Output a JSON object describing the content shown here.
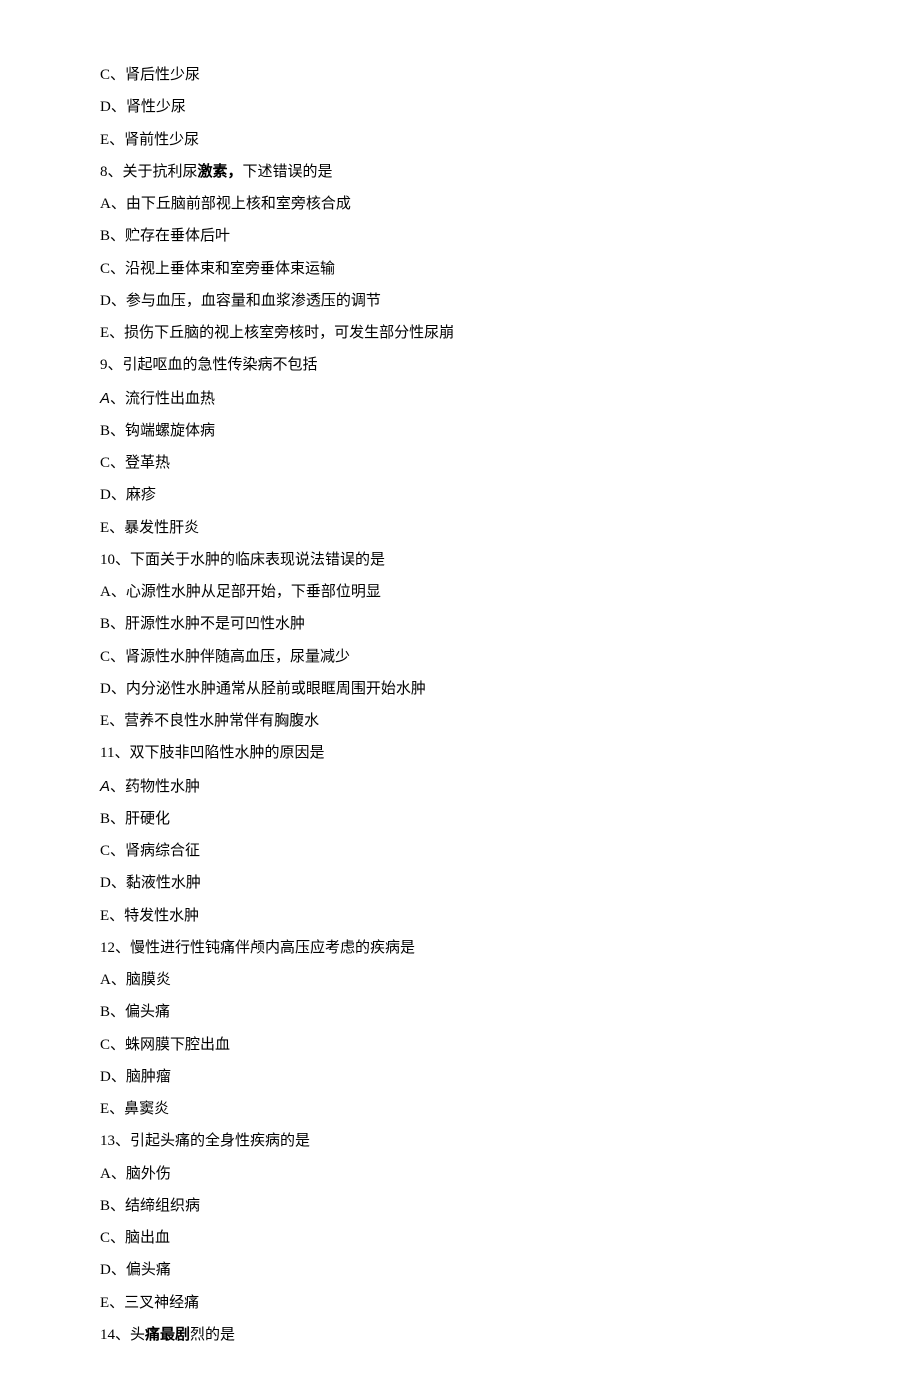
{
  "lines": [
    {
      "segments": [
        {
          "t": "C、肾后性少尿",
          "cls": ""
        }
      ]
    },
    {
      "segments": [
        {
          "t": "D、肾性少尿",
          "cls": ""
        }
      ]
    },
    {
      "segments": [
        {
          "t": "E、肾前性少尿",
          "cls": ""
        }
      ]
    },
    {
      "segments": [
        {
          "t": "8、关于抗利尿",
          "cls": ""
        },
        {
          "t": "激素，",
          "cls": "bold"
        },
        {
          "t": "下述错误的是",
          "cls": ""
        }
      ]
    },
    {
      "segments": [
        {
          "t": "A、由下丘脑前部视上核和室旁核合成",
          "cls": ""
        }
      ]
    },
    {
      "segments": [
        {
          "t": "B、贮存在垂体后叶",
          "cls": ""
        }
      ]
    },
    {
      "segments": [
        {
          "t": "C、沿视上垂体束和室旁垂体束运输",
          "cls": ""
        }
      ]
    },
    {
      "segments": [
        {
          "t": "D、参与血压，血容量和血浆渗透压的调节",
          "cls": ""
        }
      ]
    },
    {
      "segments": [
        {
          "t": "E、损伤下丘脑的视上核室旁核时，可发生部分性尿崩",
          "cls": ""
        }
      ]
    },
    {
      "segments": [
        {
          "t": "9、引起呕血的急性传染病不包括",
          "cls": ""
        }
      ]
    },
    {
      "segments": [
        {
          "t": "A",
          "cls": "sans italic"
        },
        {
          "t": "、流行性出血热",
          "cls": ""
        }
      ]
    },
    {
      "segments": [
        {
          "t": "B、钩端螺旋体病",
          "cls": ""
        }
      ]
    },
    {
      "segments": [
        {
          "t": "C、登革热",
          "cls": ""
        }
      ]
    },
    {
      "segments": [
        {
          "t": "D、麻疹",
          "cls": ""
        }
      ]
    },
    {
      "segments": [
        {
          "t": "E、暴发性肝炎",
          "cls": ""
        }
      ]
    },
    {
      "segments": [
        {
          "t": "10、下面关于水肿的临床表现说法错误的是",
          "cls": ""
        }
      ]
    },
    {
      "segments": [
        {
          "t": "A、心源性水肿从足部开始，下垂部位明显",
          "cls": ""
        }
      ]
    },
    {
      "segments": [
        {
          "t": "B、肝源性水肿不是可凹性水肿",
          "cls": ""
        }
      ]
    },
    {
      "segments": [
        {
          "t": "C、肾源性水肿伴随高血压，尿量减少",
          "cls": ""
        }
      ]
    },
    {
      "segments": [
        {
          "t": "D、内分泌性水肿通常从胫前或眼眶周围开始水肿",
          "cls": ""
        }
      ]
    },
    {
      "segments": [
        {
          "t": "E、营养不良性水肿常伴有胸腹水",
          "cls": ""
        }
      ]
    },
    {
      "segments": [
        {
          "t": "11、双下肢非凹陷性水肿的原因是",
          "cls": ""
        }
      ]
    },
    {
      "segments": [
        {
          "t": "A",
          "cls": "sans italic"
        },
        {
          "t": "、药物性水肿",
          "cls": ""
        }
      ]
    },
    {
      "segments": [
        {
          "t": "B、肝硬化",
          "cls": ""
        }
      ]
    },
    {
      "segments": [
        {
          "t": "C、肾病综合征",
          "cls": ""
        }
      ]
    },
    {
      "segments": [
        {
          "t": "D、黏液性水肿",
          "cls": ""
        }
      ]
    },
    {
      "segments": [
        {
          "t": "E、特发性水肿",
          "cls": ""
        }
      ]
    },
    {
      "segments": [
        {
          "t": "12、慢性进行性钝痛伴颅内高压应考虑的疾病是",
          "cls": ""
        }
      ]
    },
    {
      "segments": [
        {
          "t": "A、脑膜炎",
          "cls": ""
        }
      ]
    },
    {
      "segments": [
        {
          "t": "B、偏头痛",
          "cls": ""
        }
      ]
    },
    {
      "segments": [
        {
          "t": "C、蛛网膜下腔出血",
          "cls": ""
        }
      ]
    },
    {
      "segments": [
        {
          "t": "D、脑肿瘤",
          "cls": ""
        }
      ]
    },
    {
      "segments": [
        {
          "t": "E、鼻窦炎",
          "cls": ""
        }
      ]
    },
    {
      "segments": [
        {
          "t": "13、引起头痛的全身性疾病的是",
          "cls": ""
        }
      ]
    },
    {
      "segments": [
        {
          "t": "A、脑外伤",
          "cls": ""
        }
      ]
    },
    {
      "segments": [
        {
          "t": "B、结缔组织病",
          "cls": ""
        }
      ]
    },
    {
      "segments": [
        {
          "t": "C、脑出血",
          "cls": ""
        }
      ]
    },
    {
      "segments": [
        {
          "t": "D、偏头痛",
          "cls": ""
        }
      ]
    },
    {
      "segments": [
        {
          "t": "E、三叉神经痛",
          "cls": ""
        }
      ]
    },
    {
      "segments": [
        {
          "t": "14、头",
          "cls": ""
        },
        {
          "t": "痛最剧",
          "cls": "bold"
        },
        {
          "t": "烈的是",
          "cls": ""
        }
      ]
    }
  ]
}
